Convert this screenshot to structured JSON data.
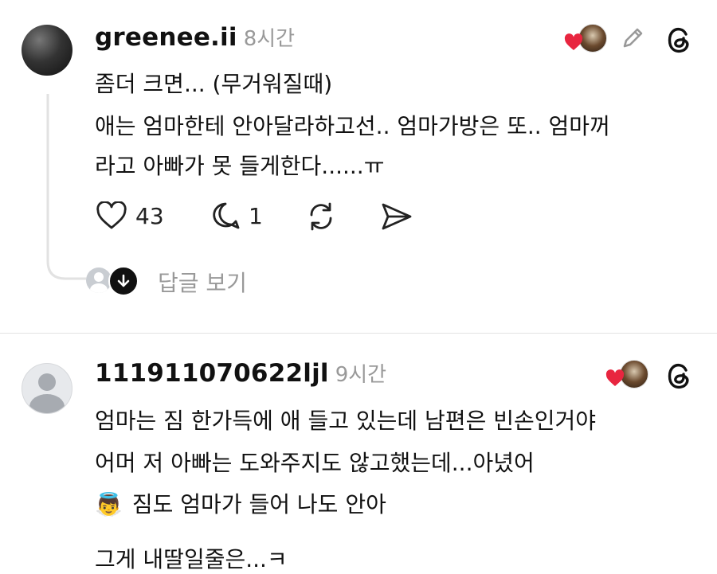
{
  "comments": [
    {
      "username": "greenee.ii",
      "time": "8시간",
      "lines": [
        "좀더 크면... (무거워질때)",
        "애는 엄마한테 안아달라하고선.. 엄마가방은 또.. 엄마꺼",
        "라고 아빠가 못 들게한다......ㅠ"
      ],
      "actions": {
        "like_count": "43",
        "reply_count": "1"
      },
      "view_replies": "답글 보기"
    },
    {
      "username": "111911070622ljl",
      "time": "9시간",
      "lines": [
        "엄마는 짐 한가득에 애 들고 있는데 남편은 빈손인거야",
        "어머 저 아빠는 도와주지도 않고했는데...아녔어",
        "짐도 엄마가 들어 나도 안아",
        "그게 내딸일줄은...ㅋ"
      ],
      "emoji": "👼"
    }
  ],
  "colors": {
    "heart": "#e8253f",
    "muted": "#999999",
    "divider": "#e3e3e3"
  }
}
